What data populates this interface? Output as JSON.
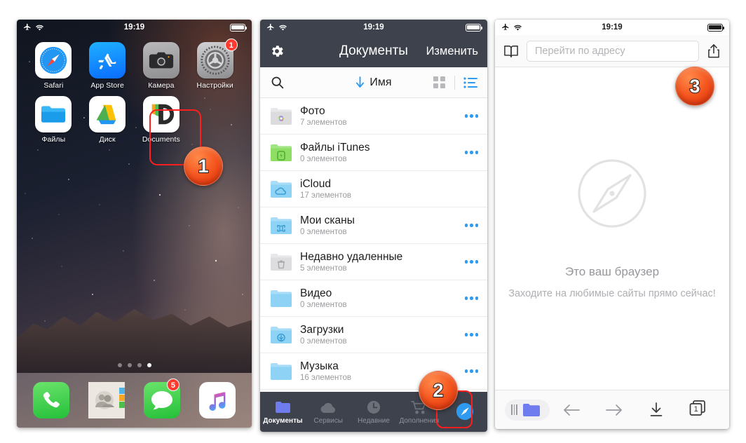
{
  "panels": {
    "home": {
      "status": {
        "time": "19:19",
        "airplane_icon": "airplane-icon",
        "wifi_icon": "wifi-icon",
        "battery_icon": "battery-icon"
      },
      "apps": [
        {
          "label": "Safari",
          "icon": "safari-icon"
        },
        {
          "label": "App Store",
          "icon": "app-store-icon"
        },
        {
          "label": "Камера",
          "icon": "camera-icon"
        },
        {
          "label": "Настройки",
          "icon": "settings-icon",
          "badge": "1"
        },
        {
          "label": "Файлы",
          "icon": "files-icon"
        },
        {
          "label": "Диск",
          "icon": "google-drive-icon"
        },
        {
          "label": "Documents",
          "icon": "documents-app-icon",
          "highlighted": true
        }
      ],
      "page_dots": {
        "count": 4,
        "active_index": 3
      },
      "dock": [
        {
          "label": "Телефон",
          "icon": "phone-icon"
        },
        {
          "label": "Контакты",
          "icon": "contacts-icon"
        },
        {
          "label": "Сообщения",
          "icon": "messages-icon",
          "badge": "5"
        },
        {
          "label": "Музыка",
          "icon": "music-icon"
        }
      ]
    },
    "documents": {
      "status": {
        "time": "19:19"
      },
      "nav": {
        "settings_icon": "gear-icon",
        "title": "Документы",
        "edit_label": "Изменить"
      },
      "toolbar": {
        "search_icon": "search-icon",
        "sort_arrow_icon": "arrow-down-icon",
        "sort_label": "Имя",
        "grid_view_icon": "grid-view-icon",
        "list_view_icon": "list-view-icon",
        "accent": "#2e9bf0"
      },
      "files": [
        {
          "name": "Фото",
          "sub": "7 элементов",
          "icon": "photos-folder-icon",
          "menu": true
        },
        {
          "name": "Файлы iTunes",
          "sub": "0 элементов",
          "icon": "itunes-folder-icon",
          "menu": true
        },
        {
          "name": "iCloud",
          "sub": "17 элементов",
          "icon": "icloud-folder-icon",
          "menu": false
        },
        {
          "name": "Мои сканы",
          "sub": "0 элементов",
          "icon": "scans-folder-icon",
          "menu": true
        },
        {
          "name": "Недавно удаленные",
          "sub": "5 элементов",
          "icon": "trash-folder-icon",
          "menu": true
        },
        {
          "name": "Видео",
          "sub": "0 элементов",
          "icon": "video-folder-icon",
          "menu": true
        },
        {
          "name": "Загрузки",
          "sub": "0 элементов",
          "icon": "downloads-folder-icon",
          "menu": true
        },
        {
          "name": "Музыка",
          "sub": "16 элементов",
          "icon": "music-folder-icon",
          "menu": true
        }
      ],
      "tabs": [
        {
          "label": "Документы",
          "icon": "folder-icon",
          "active": true
        },
        {
          "label": "Сервисы",
          "icon": "cloud-icon",
          "active": false
        },
        {
          "label": "Недавние",
          "icon": "clock-icon",
          "active": false
        },
        {
          "label": "Дополнения",
          "icon": "cart-icon",
          "active": false
        },
        {
          "label": "",
          "icon": "compass-icon",
          "active": false,
          "highlighted": true
        }
      ]
    },
    "browser": {
      "status": {
        "time": "19:19"
      },
      "top": {
        "bookmarks_icon": "book-icon",
        "address_placeholder": "Перейти по адресу",
        "address_value": "",
        "share_icon": "share-icon"
      },
      "empty_state": {
        "icon": "compass-icon",
        "title": "Это ваш браузер",
        "subtitle": "Заходите на любимые сайты прямо сейчас!"
      },
      "bottom": {
        "files_icon": "folder-icon",
        "back_icon": "arrow-left-icon",
        "forward_icon": "arrow-right-icon",
        "downloads_icon": "download-icon",
        "tabs_icon": "tabs-icon",
        "tabs_count": "1"
      }
    }
  },
  "callouts": [
    {
      "number": "1"
    },
    {
      "number": "2"
    },
    {
      "number": "3"
    }
  ]
}
